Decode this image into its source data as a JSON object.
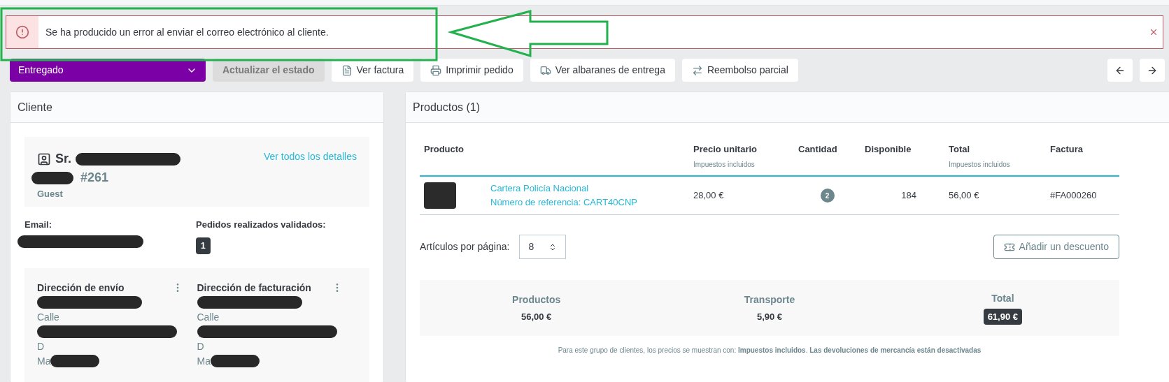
{
  "alert": {
    "message": "Se ha producido un error al enviar el correo electrónico al cliente."
  },
  "toolbar": {
    "status_select": {
      "value": "Entregado"
    },
    "update_button": {
      "label": "Actualizar el estado",
      "disabled": true
    },
    "buttons": [
      {
        "kind": "invoice",
        "label": "Ver factura"
      },
      {
        "kind": "print",
        "label": "Imprimir pedido"
      },
      {
        "kind": "delivery",
        "label": "Ver albaranes de entrega"
      },
      {
        "kind": "refund",
        "label": "Reembolso parcial"
      }
    ]
  },
  "customer": {
    "title": "Cliente",
    "salutation": "Sr.",
    "id": "#261",
    "type": "Guest",
    "details_link": "Ver todos los detalles",
    "email_label": "Email:",
    "orders_label": "Pedidos realizados validados:",
    "orders_count": "1",
    "addresses": [
      {
        "title": "Dirección de envío",
        "lines": [
          {
            "kind": "hidden"
          },
          {
            "kind": "text",
            "text": "Calle"
          },
          {
            "kind": "hidden"
          },
          {
            "kind": "text",
            "text": "D"
          },
          {
            "kind": "partial",
            "text": "Ma"
          }
        ]
      },
      {
        "title": "Dirección de facturación",
        "lines": [
          {
            "kind": "hidden"
          },
          {
            "kind": "text",
            "text": "Calle"
          },
          {
            "kind": "hidden"
          },
          {
            "kind": "text",
            "text": "D"
          },
          {
            "kind": "partial",
            "text": "Ma"
          }
        ]
      }
    ]
  },
  "products": {
    "title": "Productos (1)",
    "columns": [
      {
        "label": "Producto"
      },
      {},
      {
        "label": "Precio unitario",
        "sub": "Impuestos incluidos"
      },
      {
        "label": "Cantidad"
      },
      {
        "label": "Disponible"
      },
      {
        "label": "Total",
        "sub": "Impuestos incluidos"
      },
      {
        "label": "Factura"
      }
    ],
    "rows": [
      {
        "name": "Cartera Policía Nacional",
        "reference": "Número de referencia: CART40CNP",
        "unit_price": "28,00 €",
        "quantity": "2",
        "available": "184",
        "total": "56,00 €",
        "invoice": "#FA000260"
      }
    ],
    "per_page_label": "Artículos por página:",
    "per_page_value": "8",
    "discount_button": "Añadir un descuento",
    "summary": [
      {
        "label": "Productos",
        "value": "56,00 €",
        "highlight": false
      },
      {
        "label": "Transporte",
        "value": "5,90 €",
        "highlight": false
      },
      {
        "label": "Total",
        "value": "61,90 €",
        "highlight": true
      }
    ],
    "footnote": "Para este grupo de clientes, los precios se muestran con: **Impuestos incluidos**. **Las devoluciones de mercancía están desactivadas**"
  }
}
